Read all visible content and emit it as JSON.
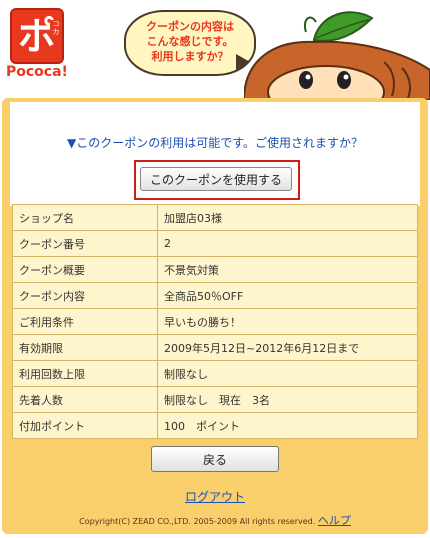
{
  "header": {
    "logo_kana": "ポ",
    "logo_small": "コカ",
    "logo_text": "Pococa!",
    "bubble_lines": [
      "クーポンの内容は",
      "こんな感じです。",
      "利用しますか？"
    ]
  },
  "main": {
    "question": "▼このクーポンの利用は可能です。ご使用されますか？",
    "use_button": "このクーポンを使用する",
    "rows": [
      {
        "label": "ショップ名",
        "value": "加盟店03様"
      },
      {
        "label": "クーポン番号",
        "value": "2"
      },
      {
        "label": "クーポン概要",
        "value": "不景気対策"
      },
      {
        "label": "クーポン内容",
        "value": "全商品50％OFF"
      },
      {
        "label": "ご利用条件",
        "value": "早いもの勝ち！"
      },
      {
        "label": "有効期限",
        "value": "2009年5月12日~2012年6月12日まで"
      },
      {
        "label": "利用回数上限",
        "value": "制限なし"
      },
      {
        "label": "先着人数",
        "value": "制限なし　現在　3名"
      },
      {
        "label": "付加ポイント",
        "value": "100　ポイント"
      }
    ],
    "back_button": "戻る",
    "logout": "ログアウト",
    "copyright": "Copyright(C) ZEAD CO.,LTD. 2005-2009 All rights reserved.",
    "help": "ヘルプ"
  },
  "colors": {
    "panel": "#f9cf6b",
    "table_cell": "#fff5cc",
    "link": "#1a4fb0",
    "brand_red": "#e8381e",
    "highlight_border": "#d11a1a"
  },
  "icons": [
    "pococa-logo",
    "speech-bubble-icon",
    "mascot-icon"
  ]
}
